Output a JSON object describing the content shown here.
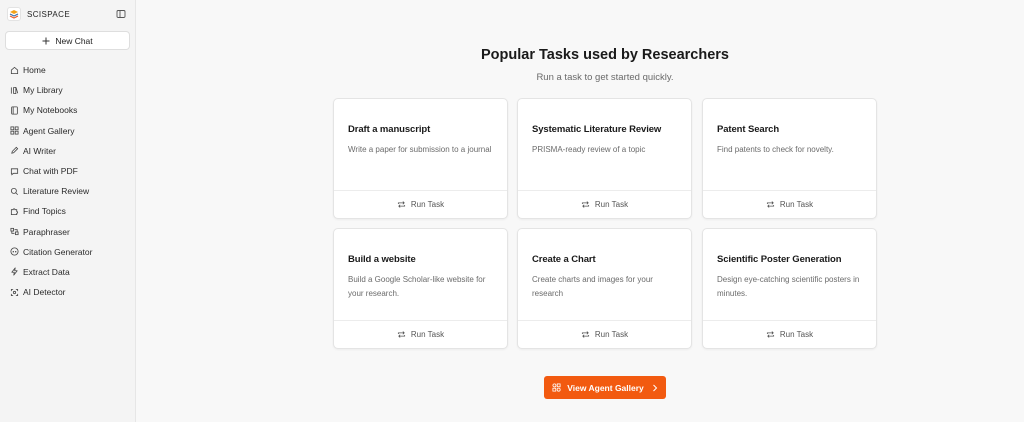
{
  "sidebar": {
    "brand": "SCISPACE",
    "new_chat_label": "New Chat",
    "items": [
      {
        "label": "Home",
        "icon": "home-icon"
      },
      {
        "label": "My Library",
        "icon": "library-icon"
      },
      {
        "label": "My Notebooks",
        "icon": "notebook-icon"
      },
      {
        "label": "Agent Gallery",
        "icon": "grid-icon"
      },
      {
        "label": "AI Writer",
        "icon": "pen-icon"
      },
      {
        "label": "Chat with PDF",
        "icon": "chat-icon"
      },
      {
        "label": "Literature Review",
        "icon": "search-icon"
      },
      {
        "label": "Find Topics",
        "icon": "puzzle-icon"
      },
      {
        "label": "Paraphraser",
        "icon": "paraphrase-icon"
      },
      {
        "label": "Citation Generator",
        "icon": "quote-icon"
      },
      {
        "label": "Extract Data",
        "icon": "bolt-icon"
      },
      {
        "label": "AI Detector",
        "icon": "detector-icon"
      }
    ]
  },
  "main": {
    "title": "Popular Tasks used by Researchers",
    "subtitle": "Run a task to get started quickly.",
    "tasks": [
      {
        "title": "Draft a manuscript",
        "description": "Write a paper for submission to a journal",
        "action": "Run Task"
      },
      {
        "title": "Systematic Literature Review",
        "description": "PRISMA-ready review of a topic",
        "action": "Run Task"
      },
      {
        "title": "Patent Search",
        "description": "Find patents to check for novelty.",
        "action": "Run Task"
      },
      {
        "title": "Build a website",
        "description": "Build a Google Scholar-like website for your research.",
        "action": "Run Task"
      },
      {
        "title": "Create a Chart",
        "description": "Create charts and images for your research",
        "action": "Run Task"
      },
      {
        "title": "Scientific Poster Generation",
        "description": "Design eye-catching scientific posters in minutes.",
        "action": "Run Task"
      }
    ],
    "cta_label": "View Agent Gallery"
  },
  "colors": {
    "accent": "#f25a10",
    "sidebar_bg": "#f4f4f4",
    "main_bg": "#f8f8f8"
  }
}
